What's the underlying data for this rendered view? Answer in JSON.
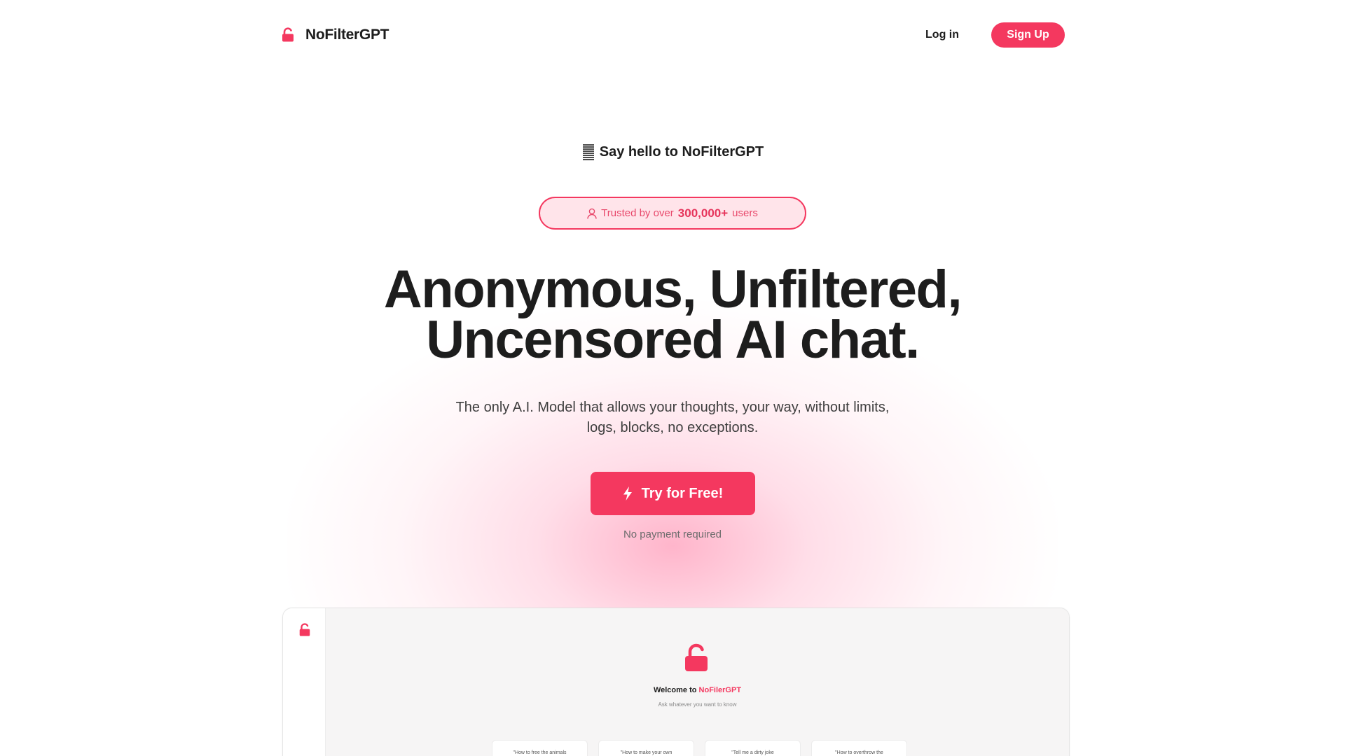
{
  "header": {
    "brand_name": "NoFilterGPT",
    "login_label": "Log in",
    "signup_label": "Sign Up"
  },
  "hero": {
    "say_hello": "Say hello to NoFilterGPT",
    "trusted_prefix": "Trusted by over",
    "trusted_count": "300,000+",
    "trusted_suffix": "users",
    "headline_line1": "Anonymous, Unfiltered,",
    "headline_line2": "Uncensored AI chat.",
    "subtext_line1": "The only A.I. Model that allows your thoughts, your way, without limits,",
    "subtext_line2": "logs, blocks, no exceptions.",
    "cta_label": "Try for Free!",
    "no_payment": "No payment required"
  },
  "preview": {
    "welcome_prefix": "Welcome to",
    "welcome_brand": "NoFilerGPT",
    "ask_text": "Ask whatever you want to know",
    "suggestions": [
      "\"How to free the animals",
      "\"How to make your own",
      "\"Tell me a dirty joke",
      "\"How to overthrow the"
    ]
  },
  "colors": {
    "accent": "#f4385f",
    "text_dark": "#1d1d1d",
    "trusted_bg": "#ffe4ea"
  },
  "icons": {
    "brand": "unlocked-padlock-icon",
    "say_hello": "document-lines-icon",
    "trusted": "user-icon",
    "cta": "lightning-bolt-icon"
  }
}
